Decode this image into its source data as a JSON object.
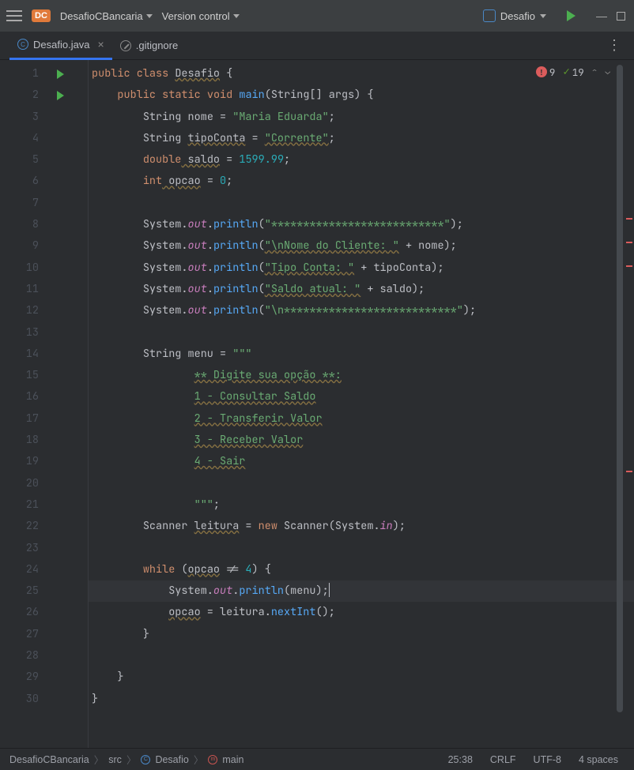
{
  "titlebar": {
    "project_badge": "DC",
    "project_name": "DesafioCBancaria",
    "vcs": "Version control",
    "run_config": "Desafio"
  },
  "tabs": [
    {
      "label": "Desafio.java",
      "active": true,
      "type": "class"
    },
    {
      "label": ".gitignore",
      "active": false,
      "type": "ignore"
    }
  ],
  "badges": {
    "errors": "9",
    "warnings": "19"
  },
  "lines": [
    "1",
    "2",
    "3",
    "4",
    "5",
    "6",
    "7",
    "8",
    "9",
    "10",
    "11",
    "12",
    "13",
    "14",
    "15",
    "16",
    "17",
    "18",
    "19",
    "20",
    "21",
    "22",
    "23",
    "24",
    "25",
    "26",
    "27",
    "28",
    "29",
    "30"
  ],
  "code": {
    "l1_kw1": "public",
    "l1_kw2": "class",
    "l1_cls": "Desafio",
    "l1_b": " {",
    "l2_kw1": "public",
    "l2_kw2": "static",
    "l2_kw3": "void",
    "l2_m": "main",
    "l2_p": "(String[] args) {",
    "l3_t": "String ",
    "l3_v": "nome",
    "l3_eq": " = ",
    "l3_s": "\"Maria Eduarda\"",
    "l3_e": ";",
    "l4_t": "String ",
    "l4_v": "tipoConta",
    "l4_eq": " = ",
    "l4_s": "\"Corrente\"",
    "l4_e": ";",
    "l5_t": "double",
    "l5_v": " saldo",
    "l5_eq": " = ",
    "l5_n": "1599.99",
    "l5_e": ";",
    "l6_t": "int",
    "l6_v": " opcao",
    "l6_eq": " = ",
    "l6_n": "0",
    "l6_e": ";",
    "l8_sys": "System.",
    "l8_out": "out",
    "l8_d": ".",
    "l8_m": "println",
    "l8_p1": "(",
    "l8_s": "\"***************************\"",
    "l8_p2": ");",
    "l9_sys": "System.",
    "l9_out": "out",
    "l9_d": ".",
    "l9_m": "println",
    "l9_p1": "(",
    "l9_s": "\"\\nNome do Cliente: \"",
    "l9_plus": " + nome);",
    "l10_sys": "System.",
    "l10_out": "out",
    "l10_d": ".",
    "l10_m": "println",
    "l10_p1": "(",
    "l10_s": "\"Tipo Conta: \"",
    "l10_plus": " + tipoConta);",
    "l11_sys": "System.",
    "l11_out": "out",
    "l11_d": ".",
    "l11_m": "println",
    "l11_p1": "(",
    "l11_s": "\"Saldo atual: \"",
    "l11_plus": " + saldo);",
    "l12_sys": "System.",
    "l12_out": "out",
    "l12_d": ".",
    "l12_m": "println",
    "l12_p1": "(",
    "l12_s": "\"\\n***************************\"",
    "l12_p2": ");",
    "l14_t": "String menu = ",
    "l14_s": "\"\"\"",
    "l15_s": "** Digite sua opção **:",
    "l16_s": "1 - Consultar Saldo",
    "l17_s": "2 - Transferir Valor",
    "l18_s": "3 - Receber Valor",
    "l19_s": "4 - Sair",
    "l21_s": "\"\"\"",
    "l21_e": ";",
    "l22_t": "Scanner ",
    "l22_v": "leitura",
    "l22_eq": " = ",
    "l22_kw": "new",
    "l22_c": " Scanner(System.",
    "l22_in": "in",
    "l22_e": ");",
    "l24_kw": "while",
    "l24_p1": " (",
    "l24_v": "opcao",
    "l24_op": " != ",
    "l24_n": "4",
    "l24_p2": ") {",
    "l25_sys": "System.",
    "l25_out": "out",
    "l25_d": ".",
    "l25_m": "println",
    "l25_p": "(menu);",
    "l26_v": "opcao",
    "l26_eq": " = leitura.",
    "l26_m": "nextInt",
    "l26_p": "();",
    "l27_b": "}",
    "l29_b": "}",
    "l30_b": "}"
  },
  "breadcrumb": {
    "project": "DesafioCBancaria",
    "src": "src",
    "class": "Desafio",
    "method": "main"
  },
  "status": {
    "pos": "25:38",
    "sep": "CRLF",
    "enc": "UTF-8",
    "indent": "4 spaces"
  }
}
